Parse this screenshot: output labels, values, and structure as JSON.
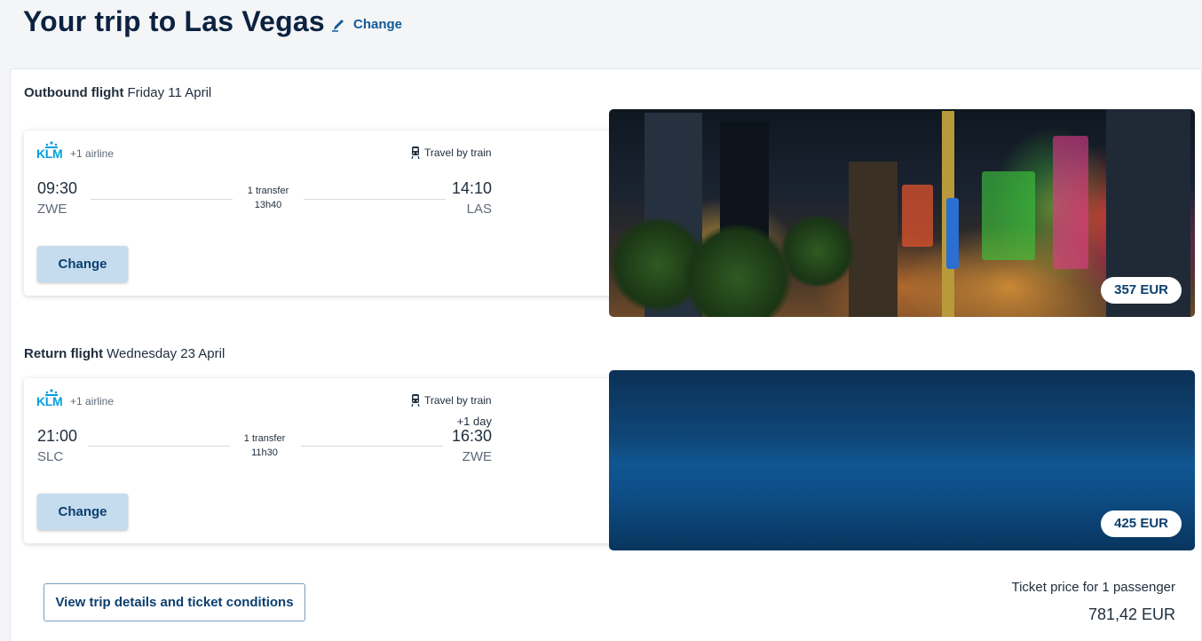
{
  "header": {
    "title": "Your trip to Las Vegas",
    "change_label": "Change"
  },
  "outbound": {
    "label": "Outbound flight",
    "date": "Friday 11 April",
    "airline": "KLM",
    "more_airlines": "+1 airline",
    "train": "Travel by train",
    "departure_time": "09:30",
    "departure_code": "ZWE",
    "arrival_time": "14:10",
    "arrival_code": "LAS",
    "transfers": "1 transfer",
    "duration": "13h40",
    "change_label": "Change",
    "price": "357 EUR"
  },
  "return": {
    "label": "Return flight",
    "date": "Wednesday 23 April",
    "airline": "KLM",
    "more_airlines": "+1 airline",
    "train": "Travel by train",
    "departure_time": "21:00",
    "departure_code": "SLC",
    "arrival_time": "16:30",
    "arrival_code": "ZWE",
    "day_offset": "+1 day",
    "transfers": "1 transfer",
    "duration": "11h30",
    "change_label": "Change",
    "price": "425 EUR"
  },
  "footer": {
    "details_button": "View trip details and ticket conditions",
    "price_label": "Ticket price for 1 passenger",
    "total": "781,42 EUR"
  },
  "colors": {
    "accent": "#135a96",
    "button_bg": "#c5dcee",
    "klm_blue": "#00a1de",
    "title": "#0b2240"
  }
}
